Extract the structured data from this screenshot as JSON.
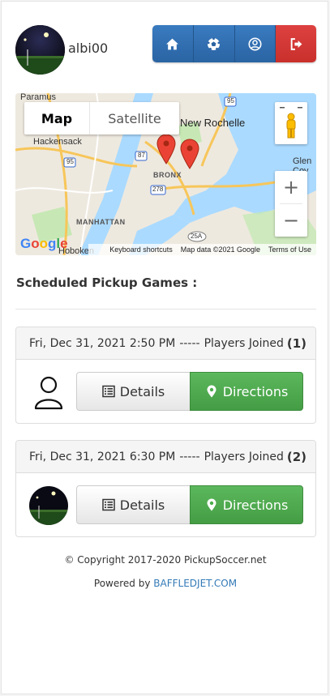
{
  "user": {
    "name": "albi00"
  },
  "nav": [
    {
      "icon": "home-icon"
    },
    {
      "icon": "soccer-ball-icon"
    },
    {
      "icon": "user-circle-icon"
    },
    {
      "icon": "sign-out-icon"
    }
  ],
  "map": {
    "type_buttons": {
      "map": "Map",
      "satellite": "Satellite"
    },
    "labels": {
      "paramus": "Paramus",
      "new_rochelle": "New Rochelle",
      "hackensack": "Hackensack",
      "bronx": "BRONX",
      "glen_cove": "Glen Cov",
      "manhattan": "MANHATTAN",
      "hoboken": "Hoboken",
      "i95_top": "95",
      "i95_left": "95",
      "i87": "87",
      "i278": "278",
      "r25a": "25A"
    },
    "zoom_in": "+",
    "zoom_out": "−",
    "google": "Google",
    "footer": {
      "shortcuts": "Keyboard shortcuts",
      "data": "Map data ©2021 Google",
      "terms": "Terms of Use"
    },
    "colors": {
      "water": "#aadaff",
      "land": "#eee9df",
      "park": "#c7e8b5",
      "highway": "#f7c65a",
      "pin": "#ea4335"
    }
  },
  "section_title": "Scheduled Pickup Games :",
  "games": [
    {
      "date": "Fri, Dec 31, 2021 2:50 PM",
      "separator": "-----",
      "players_label": "Players Joined",
      "count": "(1)",
      "avatar": "person-outline-icon",
      "details_label": "Details",
      "directions_label": "Directions"
    },
    {
      "date": "Fri, Dec 31, 2021 6:30 PM",
      "separator": "-----",
      "players_label": "Players Joined",
      "count": "(2)",
      "avatar": "field-photo-avatar",
      "details_label": "Details",
      "directions_label": "Directions"
    }
  ],
  "footer": {
    "copyright": "© Copyright 2017-2020 PickupSoccer.net",
    "powered_by": "Powered by",
    "powered_link": "BAFFLEDJET.COM"
  }
}
